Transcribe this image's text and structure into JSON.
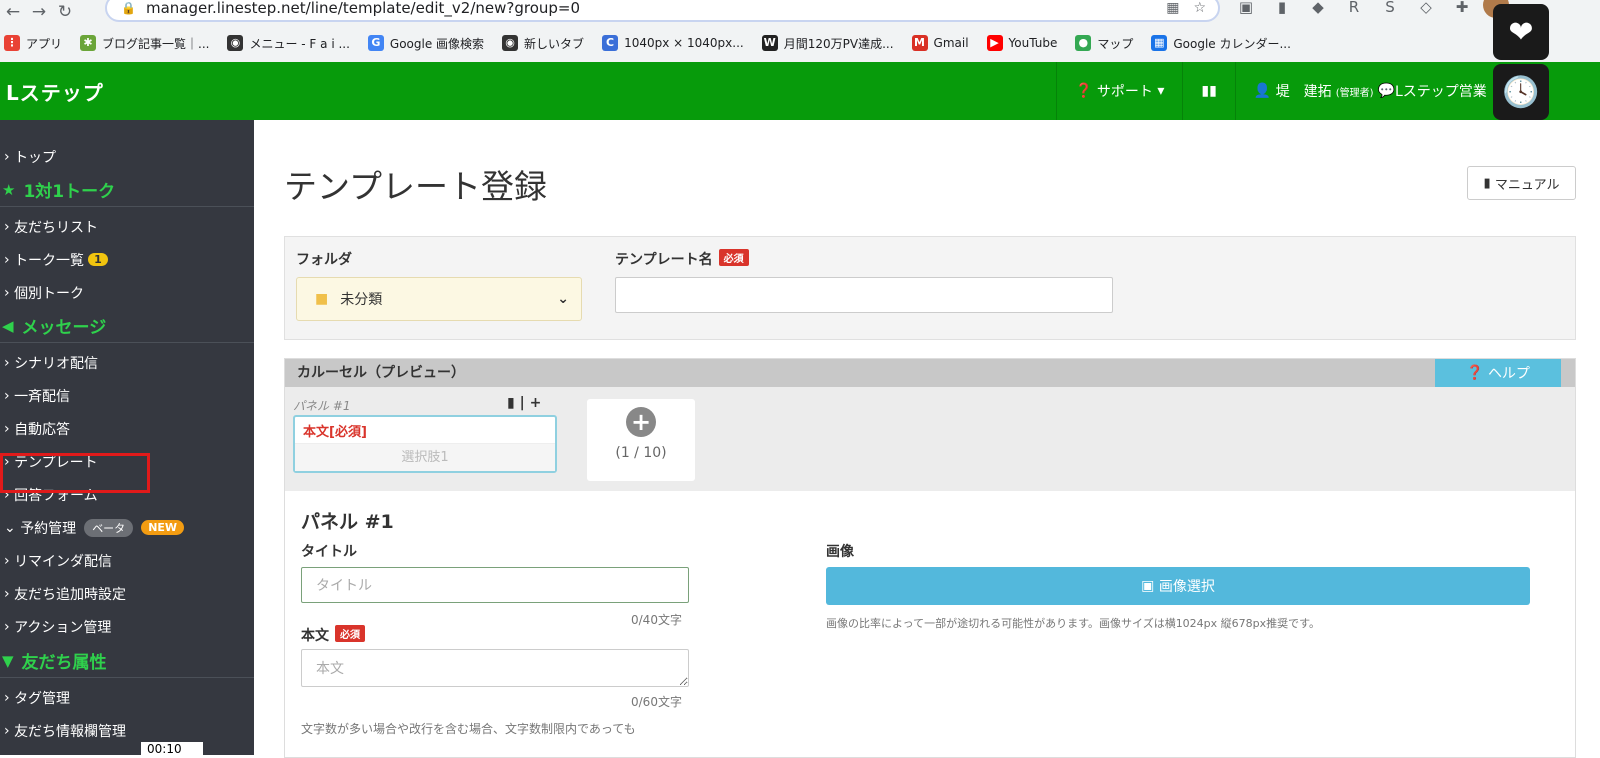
{
  "browser": {
    "url": "manager.linestep.net/line/template/edit_v2/new?group=0",
    "bookmarks": [
      {
        "label": "アプリ",
        "icon": "apps-grid-icon",
        "color": "#e94235"
      },
      {
        "label": "ブログ記事一覧｜...",
        "icon": "bug-icon",
        "color": "#6ba539"
      },
      {
        "label": "メニュー - F a i ...",
        "icon": "globe-icon",
        "color": "#333333"
      },
      {
        "label": "Google 画像検索",
        "icon": "google-icon",
        "color": "#4285f4"
      },
      {
        "label": "新しいタブ",
        "icon": "globe-icon",
        "color": "#333333"
      },
      {
        "label": "1040px × 1040px...",
        "icon": "c-icon",
        "color": "#3b6fd8"
      },
      {
        "label": "月間120万PV達成...",
        "icon": "w-icon",
        "color": "#222222"
      },
      {
        "label": "Gmail",
        "icon": "gmail-icon",
        "color": "#d93025"
      },
      {
        "label": "YouTube",
        "icon": "youtube-icon",
        "color": "#ff0000"
      },
      {
        "label": "マップ",
        "icon": "map-pin-icon",
        "color": "#34a853"
      },
      {
        "label": "Google カレンダー...",
        "icon": "calendar-icon",
        "color": "#1a73e8"
      }
    ]
  },
  "header": {
    "brand": "Lステップ",
    "support": "サポート",
    "user_name": "堤　建拓",
    "user_role": "(管理者)",
    "account": "Lステップ営業"
  },
  "sidebar": {
    "top": "トップ",
    "sec1": "1対1トーク",
    "friend_list": "友だちリスト",
    "talk_list": "トーク一覧",
    "talk_badge": "1",
    "individual": "個別トーク",
    "sec2": "メッセージ",
    "scenario": "シナリオ配信",
    "broadcast": "一斉配信",
    "auto_reply": "自動応答",
    "template": "テンプレート",
    "answer_form": "回答フォーム",
    "reservation": "予約管理",
    "beta": "ベータ",
    "new_badge": "NEW",
    "reminder": "リマインダ配信",
    "friend_add": "友だち追加時設定",
    "action": "アクション管理",
    "sec3": "友だち属性",
    "tag": "タグ管理",
    "friend_info": "友だち情報欄管理",
    "video_time": "00:10"
  },
  "main": {
    "title": "テンプレート登録",
    "manual": "マニュアル",
    "folder_label": "フォルダ",
    "folder_value": "未分類",
    "name_label": "テンプレート名",
    "required": "必須",
    "carousel_title": "カルーセル（プレビュー）",
    "help": "ヘルプ",
    "panel_tab": "パネル #1",
    "panel_body_req": "本文[必須]",
    "panel_choice": "選択肢1",
    "panel_count": "(1 / 10)",
    "panel_heading": "パネル #1",
    "title_label": "タイトル",
    "title_placeholder": "タイトル",
    "title_counter": "0/40文字",
    "body_label": "本文",
    "body_placeholder": "本文",
    "body_counter": "0/60文字",
    "note": "文字数が多い場合や改行を含む場合、文字数制限内であっても",
    "image_label": "画像",
    "image_button": "画像選択",
    "image_note": "画像の比率によって一部が途切れる可能性があります。画像サイズは横1024px 縦678px推奨です。"
  },
  "colors": {
    "header_green": "#079b0b",
    "sidebar_bg": "#353840",
    "section_green": "#2fd14c",
    "required_red": "#d9342b",
    "help_blue": "#5bc0de"
  }
}
